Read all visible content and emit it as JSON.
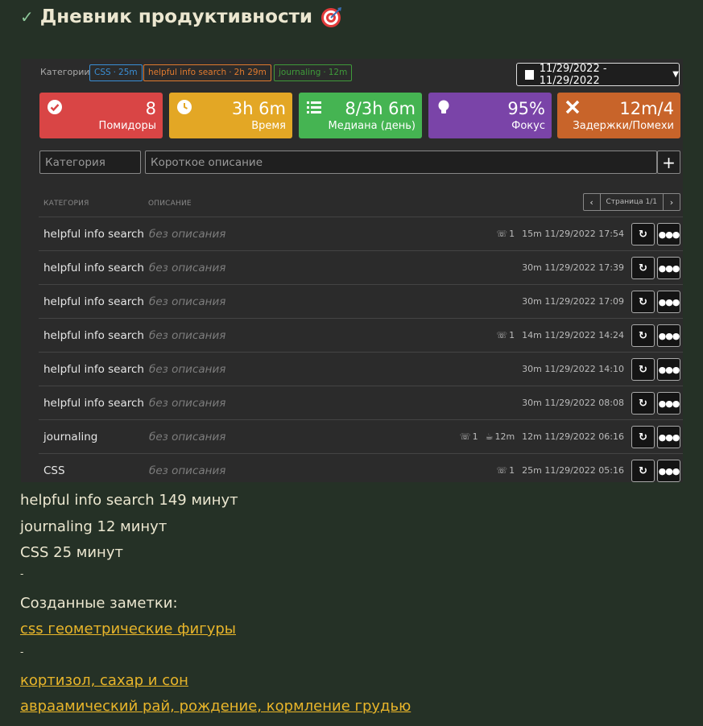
{
  "header": {
    "title": "Дневник продуктивности"
  },
  "filters": {
    "label": "Категории",
    "tags": [
      {
        "name": "CSS",
        "time": "25m",
        "color": "#3a8fd6"
      },
      {
        "name": "helpful info search",
        "time": "2h 29m",
        "color": "#e07a2e"
      },
      {
        "name": "journaling",
        "time": "12m",
        "color": "#3f9a3a"
      }
    ],
    "date_range": "11/29/2022 - 11/29/2022"
  },
  "stats": [
    {
      "value": "8",
      "label": "Помидоры",
      "icon": "check-circle-icon",
      "color": "#d94545"
    },
    {
      "value": "3h 6m",
      "label": "Время",
      "icon": "clock-icon",
      "color": "#e3a725"
    },
    {
      "value": "8/3h 6m",
      "label": "Медиана (день)",
      "icon": "list-icon",
      "color": "#45b452"
    },
    {
      "value": "95%",
      "label": "Фокус",
      "icon": "lightbulb-icon",
      "color": "#7a44a8"
    },
    {
      "value": "12m/4",
      "label": "Задержки/Помехи",
      "icon": "x-icon",
      "color": "#c8642a"
    }
  ],
  "form": {
    "category_placeholder": "Категория",
    "description_placeholder": "Короткое описание"
  },
  "table": {
    "headers": {
      "category": "КАТЕГОРИЯ",
      "description": "ОПИСАНИЕ"
    },
    "page": "Страница 1/1",
    "rows": [
      {
        "category": "helpful info search",
        "description": "без описания",
        "calls": "1",
        "breaks": "",
        "duration": "15m",
        "datetime": "11/29/2022 17:54"
      },
      {
        "category": "helpful info search",
        "description": "без описания",
        "calls": "",
        "breaks": "",
        "duration": "30m",
        "datetime": "11/29/2022 17:39"
      },
      {
        "category": "helpful info search",
        "description": "без описания",
        "calls": "",
        "breaks": "",
        "duration": "30m",
        "datetime": "11/29/2022 17:09"
      },
      {
        "category": "helpful info search",
        "description": "без описания",
        "calls": "1",
        "breaks": "",
        "duration": "14m",
        "datetime": "11/29/2022 14:24"
      },
      {
        "category": "helpful info search",
        "description": "без описания",
        "calls": "",
        "breaks": "",
        "duration": "30m",
        "datetime": "11/29/2022 14:10"
      },
      {
        "category": "helpful info search",
        "description": "без описания",
        "calls": "",
        "breaks": "",
        "duration": "30m",
        "datetime": "11/29/2022 08:08"
      },
      {
        "category": "journaling",
        "description": "без описания",
        "calls": "1",
        "breaks": "12m",
        "duration": "12m",
        "datetime": "11/29/2022 06:16"
      },
      {
        "category": "CSS",
        "description": "без описания",
        "calls": "1",
        "breaks": "",
        "duration": "25m",
        "datetime": "11/29/2022 05:16"
      }
    ]
  },
  "summary": {
    "lines": [
      "helpful info search 149 минут",
      "journaling 12 минут",
      "CSS 25 минут"
    ],
    "sep1": "-",
    "notes_heading": "Созданные заметки:",
    "link1": "css геометрические фигуры",
    "sep2": "-",
    "link2": "кортизол, сахар и сон",
    "link3": "авраамический рай, рождение, кормление грудью"
  }
}
